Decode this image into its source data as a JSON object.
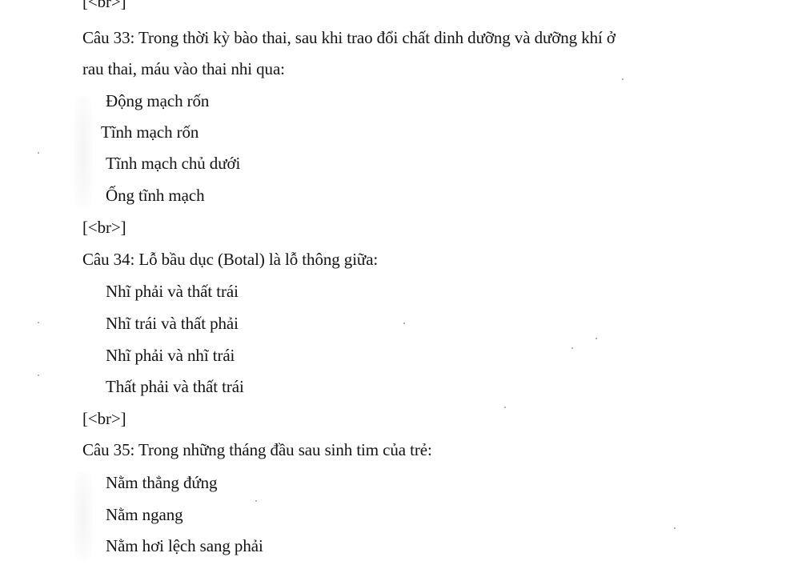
{
  "page": {
    "lines": [
      {
        "text": "[<br>]"
      },
      {
        "text": "Câu 33: Trong thời kỳ bào thai, sau khi trao đổi chất dinh dưỡng và dưỡng khí ở"
      },
      {
        "text": "rau thai, máu vào thai nhi qua:"
      },
      {
        "text": "Động mạch rốn"
      },
      {
        "text": "Tĩnh mạch rốn"
      },
      {
        "text": "Tĩnh mạch chủ dưới"
      },
      {
        "text": "Ống tĩnh mạch"
      },
      {
        "text": "[<br>]"
      },
      {
        "text": "Câu 34: Lỗ bầu dục (Botal) là lỗ thông giữa:"
      },
      {
        "text": "Nhĩ phải và thất trái"
      },
      {
        "text": "Nhĩ trái và thất phải"
      },
      {
        "text": "Nhĩ phải và nhĩ trái"
      },
      {
        "text": "Thất phải và thất trái"
      },
      {
        "text": "[<br>]"
      },
      {
        "text": "Câu 35: Trong những tháng đầu sau sinh tim của trẻ:"
      },
      {
        "text": "Nằm thẳng đứng"
      },
      {
        "text": "Nằm ngang"
      },
      {
        "text": "Nằm hơi lệch sang phải"
      }
    ]
  }
}
